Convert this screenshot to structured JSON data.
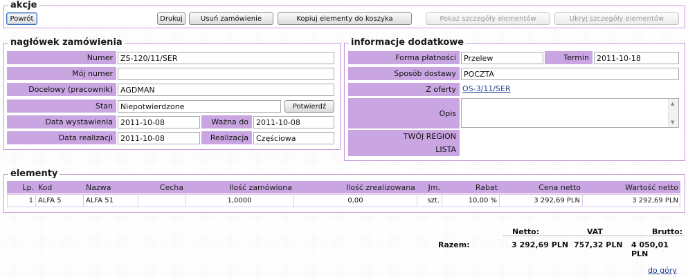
{
  "actions": {
    "legend": "akcje",
    "back": "Powrót",
    "print": "Drukuj",
    "delete_order": "Usuń zamówienie",
    "copy_to_cart": "Kopiuj elementy do koszyka",
    "show_details": "Pokaż szczegóły elementów",
    "hide_details": "Ukryj szczegóły elementów"
  },
  "header": {
    "legend": "nagłówek zamówienia",
    "number_label": "Numer",
    "number": "ZS-120/11/SER",
    "my_number_label": "Mój numer",
    "my_number": "",
    "target_label": "Docelowy (pracownik)",
    "target": "AGDMAN",
    "status_label": "Stan",
    "status": "Niepotwierdzone",
    "confirm": "Potwierdź",
    "issue_date_label": "Data wystawienia",
    "issue_date": "2011-10-08",
    "valid_label": "Ważna do",
    "valid": "2011-10-08",
    "realization_date_label": "Data realizacji",
    "realization_date": "2011-10-08",
    "realization_label": "Realizacja",
    "realization": "Częściowa"
  },
  "additional": {
    "legend": "informacje dodatkowe",
    "payment_label": "Forma płatności",
    "payment": "Przelew",
    "term_label": "Termin",
    "term": "2011-10-18",
    "delivery_label": "Sposób dostawy",
    "delivery": "POCZTA",
    "offer_label": "Z oferty",
    "offer": "OS-3/11/SER",
    "description_label": "Opis",
    "description": "",
    "region_label": "TWÓJ REGION",
    "list_label": "LISTA"
  },
  "elements": {
    "legend": "elementy",
    "columns": [
      "Lp.",
      "Kod",
      "Nazwa",
      "Cecha",
      "Ilość zamówiona",
      "Ilość zrealizowana",
      "Jm.",
      "Rabat",
      "Cena netto",
      "Wartość netto"
    ],
    "rows": [
      [
        "1",
        "ALFA 5",
        "ALFA 51",
        "",
        "1,0000",
        "0,00",
        "szt.",
        "10,00 %",
        "3 292,69 PLN",
        "3 292,69 PLN"
      ]
    ]
  },
  "totals": {
    "net_label": "Netto:",
    "vat_label": "VAT",
    "gross_label": "Brutto:",
    "sum_label": "Razem:",
    "net": "3 292,69 PLN",
    "vat": "757,32 PLN",
    "gross": "4 050,01 PLN"
  },
  "footer": {
    "top_link": "do góry"
  },
  "colors": {
    "label_bg": "#c9a5e2",
    "header_bg": "#c9a5e2",
    "border": "#c79ad6",
    "link": "#1b3f8c"
  }
}
